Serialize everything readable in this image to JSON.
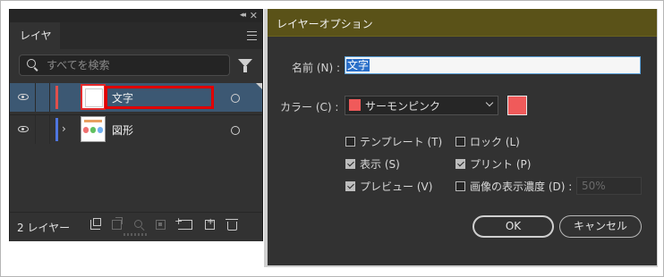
{
  "layers_panel": {
    "tab_label": "レイヤー",
    "search_placeholder": "すべてを検索",
    "layers": [
      {
        "name": "文字",
        "color": "#e0504c",
        "selected": true,
        "expandable": false
      },
      {
        "name": "図形",
        "color": "#4f76e0",
        "selected": false,
        "expandable": true
      }
    ],
    "layer_count": "2 レイヤー",
    "expand_glyph": "›"
  },
  "dialog": {
    "title": "レイヤーオプション",
    "name_label": "名前 (N) :",
    "name_value": "文字",
    "color_label": "カラー (C) :",
    "color_value": "サーモンピンク",
    "color_hex": "#f05a5a",
    "options": {
      "template": {
        "label": "テンプレート (T)",
        "checked": false
      },
      "lock": {
        "label": "ロック (L)",
        "checked": false
      },
      "show": {
        "label": "表示 (S)",
        "checked": true
      },
      "print": {
        "label": "プリント (P)",
        "checked": true
      },
      "preview": {
        "label": "プレビュー (V)",
        "checked": true
      },
      "dim": {
        "label": "画像の表示濃度 (D) :",
        "checked": false
      }
    },
    "dim_value": "50%",
    "ok_label": "OK",
    "cancel_label": "キャンセル"
  }
}
